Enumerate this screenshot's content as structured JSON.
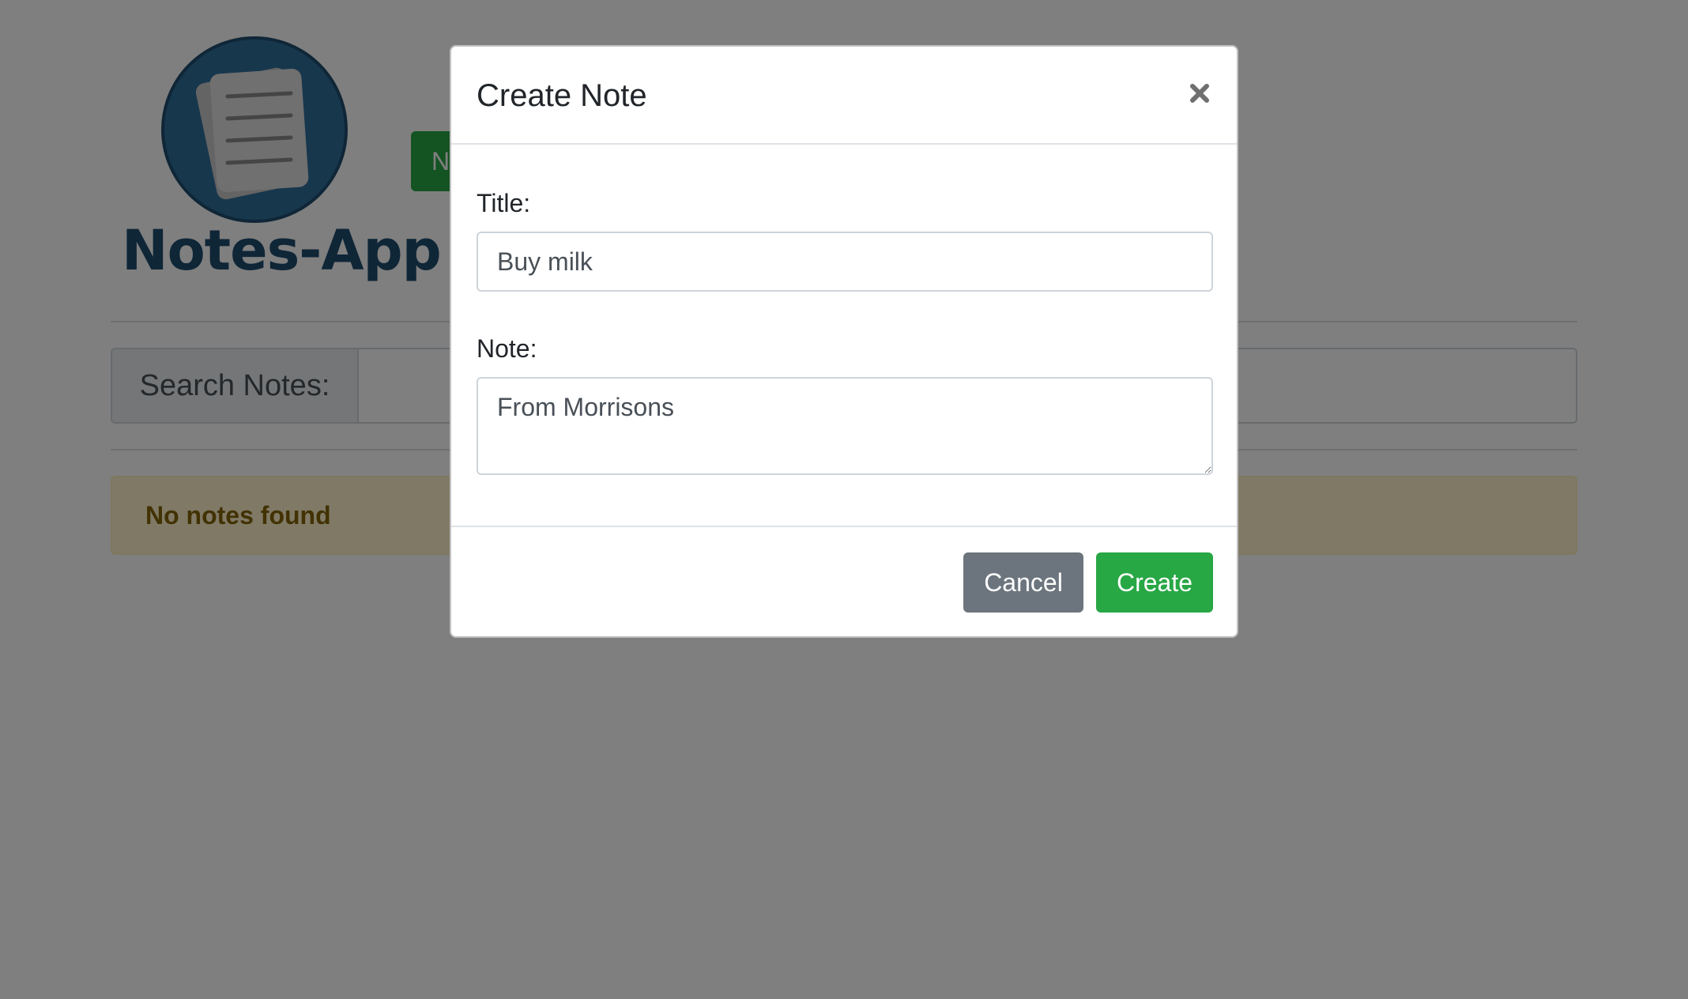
{
  "app": {
    "brand_name": "Notes-App",
    "new_note_button_label": "New Note"
  },
  "search": {
    "label": "Search Notes:",
    "value": ""
  },
  "notes_status": {
    "message": "No notes found"
  },
  "modal": {
    "title": "Create Note",
    "close_label": "×",
    "title_field": {
      "label": "Title:",
      "value": "Buy milk"
    },
    "note_field": {
      "label": "Note:",
      "value": "From Morrisons"
    },
    "cancel_label": "Cancel",
    "create_label": "Create"
  },
  "colors": {
    "brand": "#1e4d6e",
    "success": "#28a745",
    "secondary": "#6c757d",
    "warning_text": "#856404",
    "warning_bg": "#fff3cd"
  },
  "icons": {
    "logo": "notes-stack-icon",
    "close": "close-icon"
  }
}
